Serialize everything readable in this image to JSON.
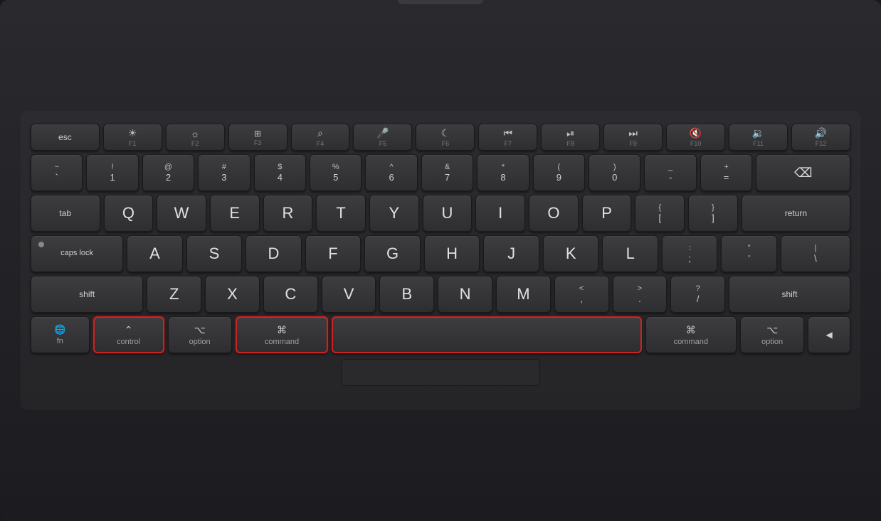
{
  "keyboard": {
    "rows": {
      "fn_row": [
        "esc",
        "F1",
        "F2",
        "F3",
        "F4",
        "F5",
        "F6",
        "F7",
        "F8",
        "F9",
        "F10",
        "F11",
        "F12"
      ],
      "num_row": [
        "`~",
        "1!",
        "2@",
        "3#",
        "4$",
        "5%",
        "6^",
        "7&",
        "8*",
        "9(",
        "0)",
        "-_",
        "=+"
      ],
      "q_row": [
        "Q",
        "W",
        "E",
        "R",
        "T",
        "Y",
        "U",
        "I",
        "O",
        "P",
        "[{",
        "]}",
        "\\|"
      ],
      "a_row": [
        "A",
        "S",
        "D",
        "F",
        "G",
        "H",
        "J",
        "K",
        "L",
        ";:",
        "'\""
      ],
      "z_row": [
        "Z",
        "X",
        "C",
        "V",
        "B",
        "N",
        "M",
        ",<",
        ".>",
        "/?"
      ],
      "bottom_row": [
        "fn",
        "control",
        "option",
        "command",
        "space",
        "command",
        "option",
        "◀"
      ]
    },
    "labels": {
      "esc": "esc",
      "tab": "tab",
      "caps_lock": "caps lock",
      "shift": "shift",
      "fn": "fn",
      "globe": "⌘",
      "control": "control",
      "option_l": "option",
      "command_l": "command",
      "space": "",
      "command_r": "command",
      "option_r": "option",
      "backspace": "⌫",
      "return": "return",
      "shift_r": "shift"
    }
  }
}
